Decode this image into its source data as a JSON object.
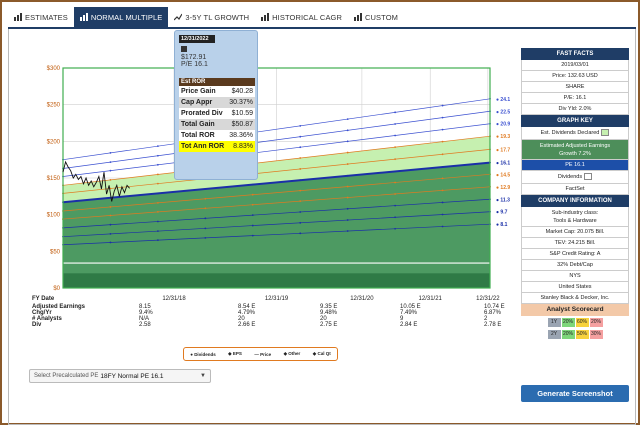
{
  "tabs": [
    {
      "label": "ESTIMATES",
      "icon": "bars-icon",
      "active": false
    },
    {
      "label": "NORMAL MULTIPLE",
      "icon": "bars-icon",
      "active": true
    },
    {
      "label": "3-5Y TL GROWTH",
      "icon": "line-chart-icon",
      "active": false
    },
    {
      "label": "HISTORICAL CAGR",
      "icon": "bars-icon",
      "active": false
    },
    {
      "label": "CUSTOM",
      "icon": "bars-icon",
      "active": false
    }
  ],
  "chart_data": {
    "type": "area",
    "y_ticks": [
      "$300",
      "$250",
      "$200",
      "$150",
      "$100",
      "$50",
      "$0"
    ],
    "ylim": [
      0,
      300
    ],
    "x_ticks": [
      "12/31/18",
      "12/31/19",
      "12/31/20",
      "12/31/21",
      "12/31/22"
    ],
    "fy_date_label": "FY Date",
    "right_labels": [
      "24.1",
      "22.5",
      "20.9",
      "19.3",
      "17.7",
      "16.1",
      "14.5",
      "12.9",
      "11.3",
      "9.7",
      "8.1"
    ],
    "pe_lines": [
      {
        "name": "24.1",
        "start": 175,
        "end": 258,
        "color": "#3a4fd0"
      },
      {
        "name": "22.5",
        "start": 163,
        "end": 241,
        "color": "#3a4fd0"
      },
      {
        "name": "20.9",
        "start": 152,
        "end": 224,
        "color": "#3a4fd0"
      },
      {
        "name": "19.3",
        "start": 140,
        "end": 207,
        "color": "#e07a20"
      },
      {
        "name": "17.7",
        "start": 129,
        "end": 189,
        "color": "#e07a20"
      },
      {
        "name": "16.1",
        "start": 117,
        "end": 171,
        "color": "#1a2fa8"
      },
      {
        "name": "14.5",
        "start": 105,
        "end": 155,
        "color": "#e07a20"
      },
      {
        "name": "12.9",
        "start": 94,
        "end": 138,
        "color": "#e07a20"
      },
      {
        "name": "11.3",
        "start": 82,
        "end": 121,
        "color": "#1a2fa8"
      },
      {
        "name": "9.7",
        "start": 70,
        "end": 104,
        "color": "#1a2fa8"
      },
      {
        "name": "8.1",
        "start": 59,
        "end": 87,
        "color": "#1a2fa8"
      }
    ],
    "price_series": [
      {
        "x": 0.0,
        "y": 158
      },
      {
        "x": 0.03,
        "y": 172
      },
      {
        "x": 0.06,
        "y": 165
      },
      {
        "x": 0.09,
        "y": 160
      },
      {
        "x": 0.12,
        "y": 150
      },
      {
        "x": 0.15,
        "y": 155
      },
      {
        "x": 0.18,
        "y": 148
      },
      {
        "x": 0.21,
        "y": 152
      },
      {
        "x": 0.24,
        "y": 142
      },
      {
        "x": 0.27,
        "y": 150
      },
      {
        "x": 0.3,
        "y": 140
      },
      {
        "x": 0.33,
        "y": 146
      },
      {
        "x": 0.36,
        "y": 138
      },
      {
        "x": 0.39,
        "y": 144
      },
      {
        "x": 0.42,
        "y": 152
      },
      {
        "x": 0.45,
        "y": 135
      },
      {
        "x": 0.48,
        "y": 158
      },
      {
        "x": 0.51,
        "y": 128
      },
      {
        "x": 0.54,
        "y": 140
      },
      {
        "x": 0.57,
        "y": 118
      },
      {
        "x": 0.6,
        "y": 132
      },
      {
        "x": 0.63,
        "y": 140
      },
      {
        "x": 0.66,
        "y": 125
      },
      {
        "x": 0.69,
        "y": 138
      },
      {
        "x": 0.72,
        "y": 130
      },
      {
        "x": 0.75,
        "y": 140
      },
      {
        "x": 0.78,
        "y": 136
      }
    ],
    "dividend_floor": 20,
    "colors": {
      "light_green": "#c6f0b0",
      "mid_green": "#4d9a62",
      "dark_green": "#2f7a46",
      "border_green": "#3fae4f",
      "grid": "#cfcfcf",
      "price": "#111111",
      "pe_main": "#1a2fa8"
    }
  },
  "data_rows": {
    "labels": [
      "Adjusted Earnings",
      "Chg/Yr",
      "# Analysts",
      "Div"
    ],
    "columns": [
      {
        "values": [
          "8.15",
          "9.4%",
          "N/A",
          "2.58"
        ]
      },
      {
        "values": [
          "8.54 E",
          "4.79%",
          "20",
          "2.66 E"
        ]
      },
      {
        "values": [
          "9.35 E",
          "9.48%",
          "20",
          "2.75 E"
        ]
      },
      {
        "values": [
          "10.05 E",
          "7.49%",
          "9",
          "2.84 E"
        ]
      },
      {
        "values": [
          "10.74 E",
          "6.87%",
          "2",
          "2.78 E"
        ]
      }
    ]
  },
  "legend": [
    "Dividends",
    "EPS",
    "Price",
    "Other",
    "Cal Qt"
  ],
  "select": {
    "prefix": "Select Precalculated PE",
    "value": "18FY Normal PE 16.1"
  },
  "tooltip": {
    "date": "12/31/2022",
    "price": "$172.91",
    "pe": "P/E 16.1",
    "header": "Est ROR",
    "rows": [
      {
        "k": "Price Gain",
        "v": "$40.28",
        "style": "w"
      },
      {
        "k": "Cap Appr",
        "v": "30.37%",
        "style": "g"
      },
      {
        "k": "Prorated Div",
        "v": "$10.59",
        "style": "w"
      },
      {
        "k": "Total Gain",
        "v": "$50.87",
        "style": "g"
      },
      {
        "k": "Total ROR",
        "v": "38.36%",
        "style": "w"
      },
      {
        "k": "Tot Ann ROR",
        "v": "8.83%",
        "style": "y"
      }
    ]
  },
  "fast_facts": {
    "title": "FAST FACTS",
    "date": "2019/03/01",
    "price": "Price: 132.63 USD",
    "share": "SHARE",
    "pe": "P/E: 16.1",
    "div_yld": "Div Yld: 2.0%"
  },
  "graph_key": {
    "title": "GRAPH KEY",
    "est_div": "Est. Dividends Declared",
    "growth_line1": "Estimated Adjusted Earnings",
    "growth_line2": "Growth 7.2%",
    "pe": "PE 16.1",
    "dividends": "Dividends",
    "factset": "FactSet"
  },
  "company": {
    "title": "COMPANY INFORMATION",
    "subind_label": "Sub-industry class:",
    "subind_value": "Tools & Hardware",
    "market_cap": "Market Cap: 20.075 Bill.",
    "tev": "TEV: 24.215 Bill.",
    "credit": "S&P Credit Rating: A",
    "debt": "32% Debt/Cap",
    "exchange": "NYS",
    "country": "United States",
    "name": "Stanley Black & Decker, Inc."
  },
  "scorecard": {
    "title": "Analyst Scorecard",
    "rows": [
      {
        "cells": [
          "1Y",
          "20%",
          "60%",
          "20%"
        ],
        "colors": [
          "#9aa4b2",
          "#7dd67a",
          "#f7d23c",
          "#f5a0a0"
        ]
      },
      {
        "cells": [
          "2Y",
          "20%",
          "50%",
          "30%"
        ],
        "colors": [
          "#9aa4b2",
          "#7dd67a",
          "#f7d23c",
          "#f5a0a0"
        ]
      }
    ]
  },
  "generate_button": "Generate Screenshot"
}
